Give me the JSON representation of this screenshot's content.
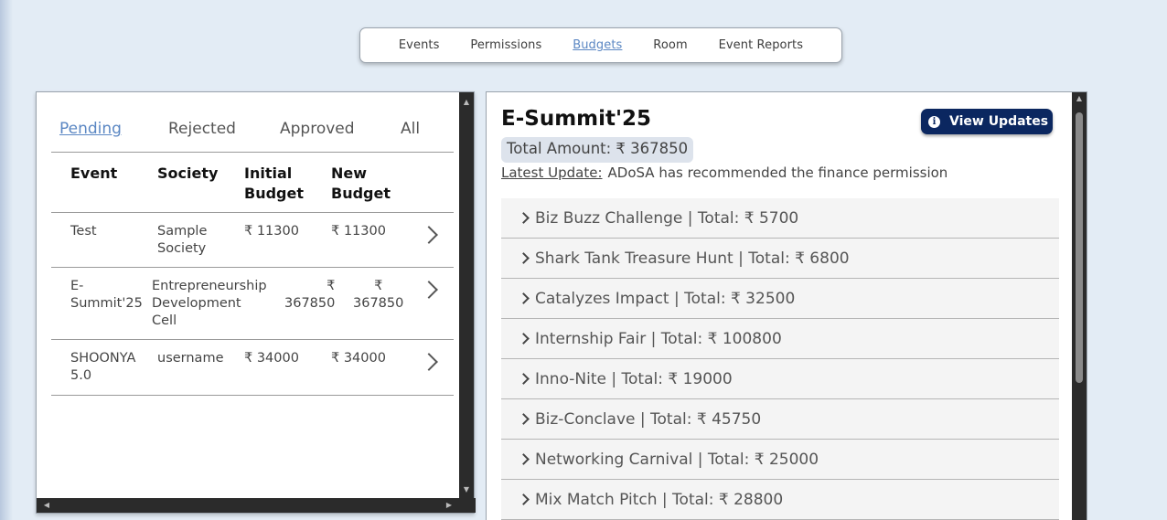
{
  "nav": {
    "items": [
      "Events",
      "Permissions",
      "Budgets",
      "Room",
      "Event Reports"
    ],
    "active": "Budgets"
  },
  "filters": {
    "tabs": [
      "Pending",
      "Rejected",
      "Approved",
      "All"
    ],
    "active": "Pending"
  },
  "table": {
    "headers": [
      "Event",
      "Society",
      "Initial\nBudget",
      "New\nBudget"
    ],
    "rows": [
      {
        "event": "Test",
        "society": "Sample\nSociety",
        "initial": "₹ 11300",
        "new": "₹ 11300"
      },
      {
        "event": "E-\nSummit'25",
        "society": "Entrepreneurship\nDevelopment\nCell",
        "initial": "₹\n367850",
        "new": "₹\n367850"
      },
      {
        "event": "SHOONYA\n5.0",
        "society": "username",
        "initial": "₹ 34000",
        "new": "₹ 34000"
      }
    ]
  },
  "detail": {
    "title": "E-Summit'25",
    "view_updates_label": "View Updates",
    "total_amount": "Total Amount: ₹ 367850",
    "latest_update_label": "Latest Update:",
    "latest_update_text": "ADoSA has recommended the finance permission",
    "sub_events": [
      "Biz Buzz Challenge | Total: ₹ 5700",
      "Shark Tank Treasure Hunt | Total: ₹ 6800",
      "Catalyzes Impact | Total: ₹ 32500",
      "Internship Fair | Total: ₹ 100800",
      "Inno-Nite | Total: ₹ 19000",
      "Biz-Conclave | Total: ₹ 45750",
      "Networking Carnival | Total: ₹ 25000",
      "Mix Match Pitch | Total: ₹ 28800"
    ]
  },
  "icons": {
    "info": "info-icon",
    "chevron_right": "chevron-right-icon"
  },
  "colors": {
    "active_link": "#5b87c3",
    "button_bg": "#0b2760"
  }
}
